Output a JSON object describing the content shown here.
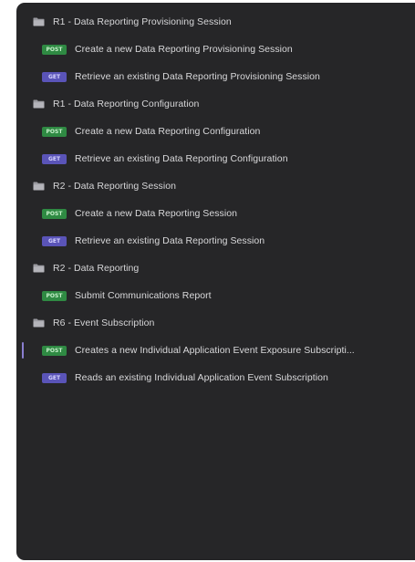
{
  "colors": {
    "panel_bg": "#262628",
    "post_badge": "#2f8a43",
    "get_badge": "#5a54b8",
    "text": "#d9d9db",
    "active_indicator": "#8a7fd0"
  },
  "tree": {
    "items": [
      {
        "type": "folder",
        "icon": "folder-icon",
        "label": "R1 - Data Reporting Provisioning Session"
      },
      {
        "type": "request",
        "method": "POST",
        "label": "Create a new Data Reporting Provisioning Session"
      },
      {
        "type": "request",
        "method": "GET",
        "label": "Retrieve an existing Data Reporting Provisioning Session"
      },
      {
        "type": "folder",
        "icon": "folder-icon",
        "label": "R1 - Data Reporting Configuration"
      },
      {
        "type": "request",
        "method": "POST",
        "label": "Create a new Data Reporting Configuration"
      },
      {
        "type": "request",
        "method": "GET",
        "label": "Retrieve an existing Data Reporting Configuration"
      },
      {
        "type": "folder",
        "icon": "folder-icon",
        "label": "R2 - Data Reporting Session"
      },
      {
        "type": "request",
        "method": "POST",
        "label": "Create a new Data Reporting Session"
      },
      {
        "type": "request",
        "method": "GET",
        "label": "Retrieve an existing Data Reporting Session"
      },
      {
        "type": "folder",
        "icon": "folder-icon",
        "label": "R2 - Data Reporting"
      },
      {
        "type": "request",
        "method": "POST",
        "label": "Submit Communications Report"
      },
      {
        "type": "folder",
        "icon": "folder-icon",
        "label": "R6 - Event Subscription"
      },
      {
        "type": "request",
        "method": "POST",
        "label": "Creates a new Individual Application Event Exposure Subscripti...",
        "active": true
      },
      {
        "type": "request",
        "method": "GET",
        "label": "Reads an existing Individual Application Event Subscription"
      }
    ]
  }
}
